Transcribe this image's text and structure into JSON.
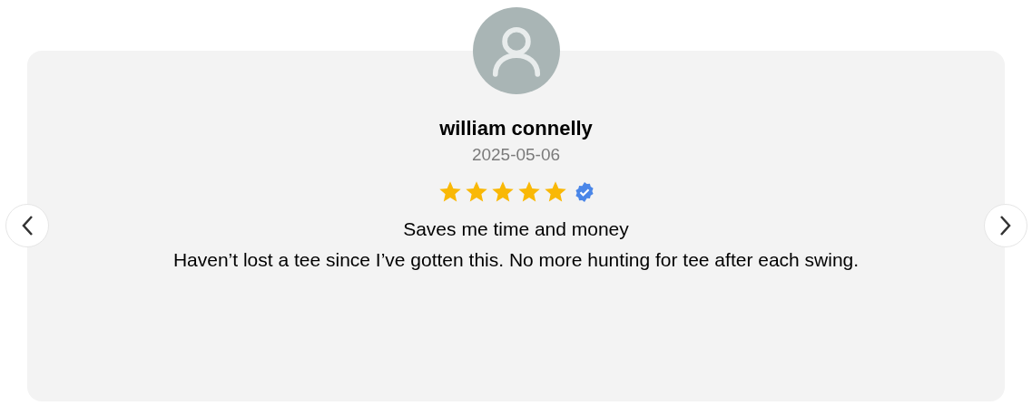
{
  "review": {
    "name": "william connelly",
    "date": "2025-05-06",
    "stars": 5,
    "verified": true,
    "title": "Saves me time and money",
    "body": "Haven’t lost a tee since I’ve gotten this. No more hunting for tee after each swing."
  }
}
